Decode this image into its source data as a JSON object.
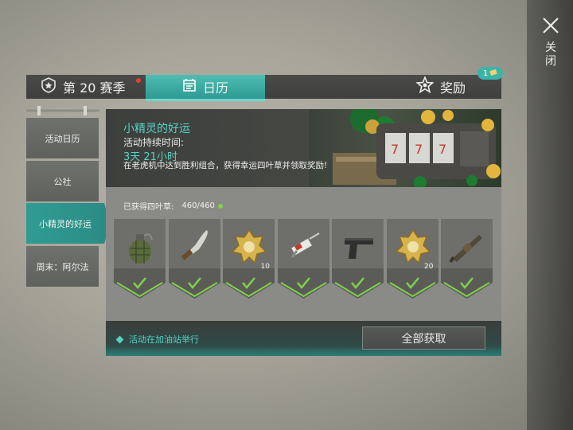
{
  "close": {
    "label": "关闭",
    "icon": "close-icon"
  },
  "tabs": {
    "season": {
      "label": "第 20 赛季",
      "icon": "season-shield-icon",
      "has_alert": true
    },
    "calendar": {
      "label": "日历",
      "icon": "calendar-icon",
      "active": true
    },
    "rewards": {
      "label": "奖励",
      "icon": "star-icon",
      "badge_count": "1"
    }
  },
  "sidebar": {
    "items": [
      {
        "label": "活动日历",
        "active": false
      },
      {
        "label": "公社",
        "active": false
      },
      {
        "label": "小精灵的好运",
        "active": true
      },
      {
        "label": "周末：阿尔法",
        "active": false
      }
    ]
  },
  "event": {
    "title": "小精灵的好运",
    "duration_label": "活动持续时间:",
    "duration_value": "3天 21小时",
    "description": "在老虎机中达到胜利组合，获得幸运四叶草并领取奖励!"
  },
  "progress": {
    "label": "已获得四叶草:",
    "value": "460/460"
  },
  "rewards": [
    {
      "icon": "grenade-icon",
      "count": "",
      "claimed": true
    },
    {
      "icon": "machete-icon",
      "count": "",
      "claimed": true
    },
    {
      "icon": "gold-badge-icon",
      "count": "10",
      "claimed": true
    },
    {
      "icon": "syringe-icon",
      "count": "",
      "claimed": true
    },
    {
      "icon": "pistol-icon",
      "count": "",
      "claimed": true
    },
    {
      "icon": "gold-badge-icon",
      "count": "20",
      "claimed": true
    },
    {
      "icon": "rifle-icon",
      "count": "",
      "claimed": true
    }
  ],
  "footer": {
    "note": "活动在加油站举行",
    "claim_all_label": "全部获取"
  },
  "colors": {
    "accent": "#3cb4a7",
    "check": "#7fd24a",
    "alert": "#e0413b"
  }
}
